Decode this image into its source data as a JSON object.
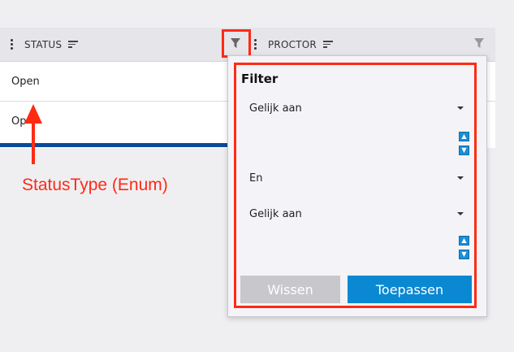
{
  "grid": {
    "columns": [
      {
        "label": "STATUS"
      },
      {
        "label": "PROCTOR"
      }
    ],
    "rows": [
      {
        "status": "Open"
      },
      {
        "status": "Op"
      }
    ]
  },
  "filter_popup": {
    "title": "Filter",
    "condition1": {
      "operator": "Gelijk aan",
      "value": ""
    },
    "logic": "En",
    "condition2": {
      "operator": "Gelijk aan",
      "value": ""
    },
    "clear_label": "Wissen",
    "apply_label": "Toepassen"
  },
  "annotation": {
    "text": "StatusType (Enum)"
  },
  "colors": {
    "accent": "#1a8fd6",
    "annotation_red": "#ff2a14",
    "clear_button": "#c8c8cc",
    "apply_button": "#0a88d2",
    "row_underline": "#0a4a9a"
  },
  "icons": [
    "column-menu-icon",
    "sort-icon",
    "filter-icon",
    "dropdown-caret-icon",
    "spin-up-icon",
    "spin-down-icon"
  ]
}
